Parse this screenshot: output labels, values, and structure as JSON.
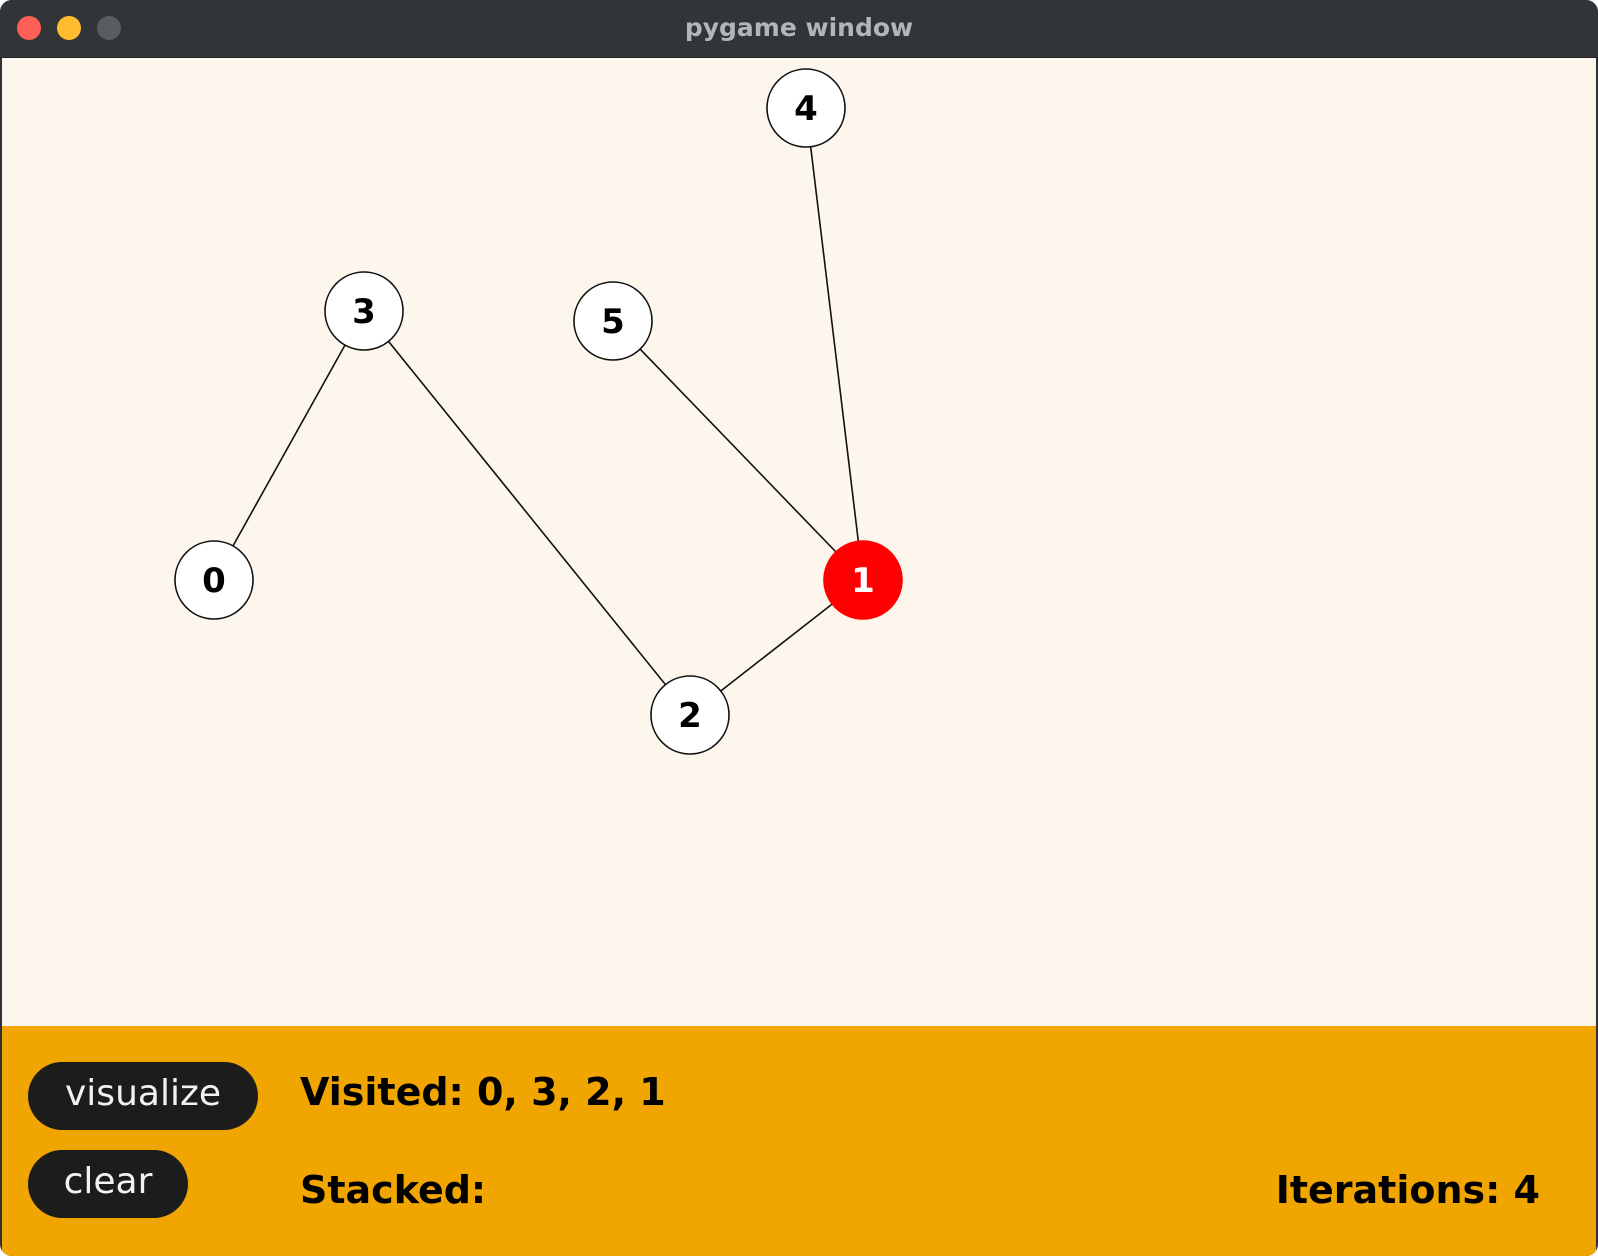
{
  "window": {
    "title": "pygame window"
  },
  "colors": {
    "canvas_bg": "#fdf6ec",
    "panel_bg": "#f0a500",
    "node_fill": "#ffffff",
    "node_active_fill": "#ff0000",
    "button_bg": "#1c1c1c"
  },
  "graph": {
    "nodes": [
      {
        "id": "0",
        "label": "0",
        "active": false
      },
      {
        "id": "1",
        "label": "1",
        "active": true
      },
      {
        "id": "2",
        "label": "2",
        "active": false
      },
      {
        "id": "3",
        "label": "3",
        "active": false
      },
      {
        "id": "4",
        "label": "4",
        "active": false
      },
      {
        "id": "5",
        "label": "5",
        "active": false
      }
    ],
    "edges": [
      [
        "3",
        "0"
      ],
      [
        "3",
        "2"
      ],
      [
        "2",
        "1"
      ],
      [
        "5",
        "1"
      ],
      [
        "4",
        "1"
      ]
    ]
  },
  "panel": {
    "visualize_label": "visualize",
    "clear_label": "clear",
    "visited_text": "Visited: 0, 3, 2, 1",
    "stacked_text": "Stacked:",
    "iterations_text": "Iterations: 4"
  }
}
